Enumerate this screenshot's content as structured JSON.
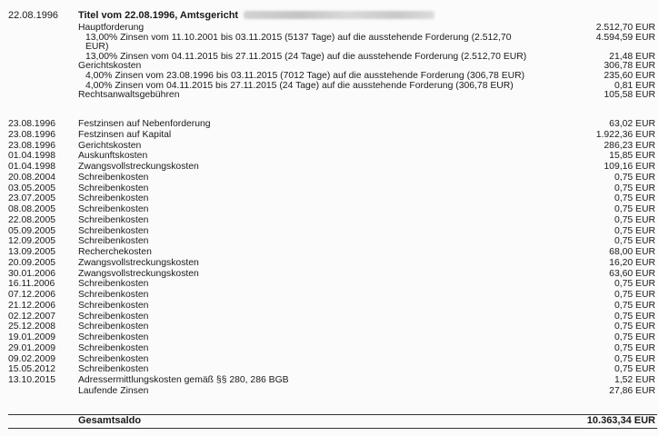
{
  "header": {
    "date": "22.08.1996",
    "title": "Titel vom 22.08.1996, Amtsgericht"
  },
  "detail": [
    {
      "text": "Hauptforderung",
      "amount": "2.512,70 EUR",
      "indent": 1
    },
    {
      "text": "13,00%  Zinsen vom 11.10.2001 bis 03.11.2015 (5137 Tage) auf die ausstehende Forderung (2.512,70",
      "amount": "4.594,59 EUR",
      "indent": 2
    },
    {
      "text": "EUR)",
      "amount": "",
      "indent": 2
    },
    {
      "text": "13,00%  Zinsen vom 04.11.2015 bis 27.11.2015 (24 Tage) auf die ausstehende Forderung (2.512,70 EUR)",
      "amount": "21,48 EUR",
      "indent": 2
    },
    {
      "text": "Gerichtskosten",
      "amount": "306,78 EUR",
      "indent": 1
    },
    {
      "text": "4,00%  Zinsen vom 23.08.1996 bis 03.11.2015 (7012 Tage) auf die ausstehende Forderung (306,78 EUR)",
      "amount": "235,60 EUR",
      "indent": 2
    },
    {
      "text": "4,00%  Zinsen vom 04.11.2015 bis 27.11.2015 (24 Tage) auf die ausstehende Forderung (306,78 EUR)",
      "amount": "0,81 EUR",
      "indent": 2
    },
    {
      "text": "Rechtsanwaltsgebühren",
      "amount": "105,58 EUR",
      "indent": 1
    }
  ],
  "entries": [
    {
      "date": "23.08.1996",
      "desc": "Festzinsen auf Nebenforderung",
      "amount": "63,02 EUR"
    },
    {
      "date": "23.08.1996",
      "desc": "Festzinsen auf Kapital",
      "amount": "1.922,36 EUR"
    },
    {
      "date": "23.08.1996",
      "desc": "Gerichtskosten",
      "amount": "286,23 EUR"
    },
    {
      "date": "01.04.1998",
      "desc": "Auskunftskosten",
      "amount": "15,85 EUR"
    },
    {
      "date": "01.04.1998",
      "desc": "Zwangsvollstreckungskosten",
      "amount": "109,16 EUR"
    },
    {
      "date": "20.08.2004",
      "desc": "Schreibenkosten",
      "amount": "0,75 EUR"
    },
    {
      "date": "03.05.2005",
      "desc": "Schreibenkosten",
      "amount": "0,75 EUR"
    },
    {
      "date": "23.07.2005",
      "desc": "Schreibenkosten",
      "amount": "0,75 EUR"
    },
    {
      "date": "08.08.2005",
      "desc": "Schreibenkosten",
      "amount": "0,75 EUR"
    },
    {
      "date": "22.08.2005",
      "desc": "Schreibenkosten",
      "amount": "0,75 EUR"
    },
    {
      "date": "05.09.2005",
      "desc": "Schreibenkosten",
      "amount": "0,75 EUR"
    },
    {
      "date": "12.09.2005",
      "desc": "Schreibenkosten",
      "amount": "0,75 EUR"
    },
    {
      "date": "13.09.2005",
      "desc": "Recherchekosten",
      "amount": "68,00 EUR"
    },
    {
      "date": "20.09.2005",
      "desc": "Zwangsvollstreckungskosten",
      "amount": "16,20 EUR"
    },
    {
      "date": "30.01.2006",
      "desc": "Zwangsvollstreckungskosten",
      "amount": "63,60 EUR"
    },
    {
      "date": "16.11.2006",
      "desc": "Schreibenkosten",
      "amount": "0,75 EUR"
    },
    {
      "date": "07.12.2006",
      "desc": "Schreibenkosten",
      "amount": "0,75 EUR"
    },
    {
      "date": "21.12.2006",
      "desc": "Schreibenkosten",
      "amount": "0,75 EUR"
    },
    {
      "date": "02.12.2007",
      "desc": "Schreibenkosten",
      "amount": "0,75 EUR"
    },
    {
      "date": "25.12.2008",
      "desc": "Schreibenkosten",
      "amount": "0,75 EUR"
    },
    {
      "date": "19.01.2009",
      "desc": "Schreibenkosten",
      "amount": "0,75 EUR"
    },
    {
      "date": "29.01.2009",
      "desc": "Schreibenkosten",
      "amount": "0,75 EUR"
    },
    {
      "date": "09.02.2009",
      "desc": "Schreibenkosten",
      "amount": "0,75 EUR"
    },
    {
      "date": "15.05.2012",
      "desc": "Schreibenkosten",
      "amount": "0,75 EUR"
    },
    {
      "date": "13.10.2015",
      "desc": "Adressermittlungskosten gemäß §§ 280, 286 BGB",
      "amount": "1,52 EUR"
    },
    {
      "date": "",
      "desc": "Laufende Zinsen",
      "amount": "27,86 EUR"
    }
  ],
  "total": {
    "label": "Gesamtsaldo",
    "amount": "10.363,34 EUR"
  }
}
